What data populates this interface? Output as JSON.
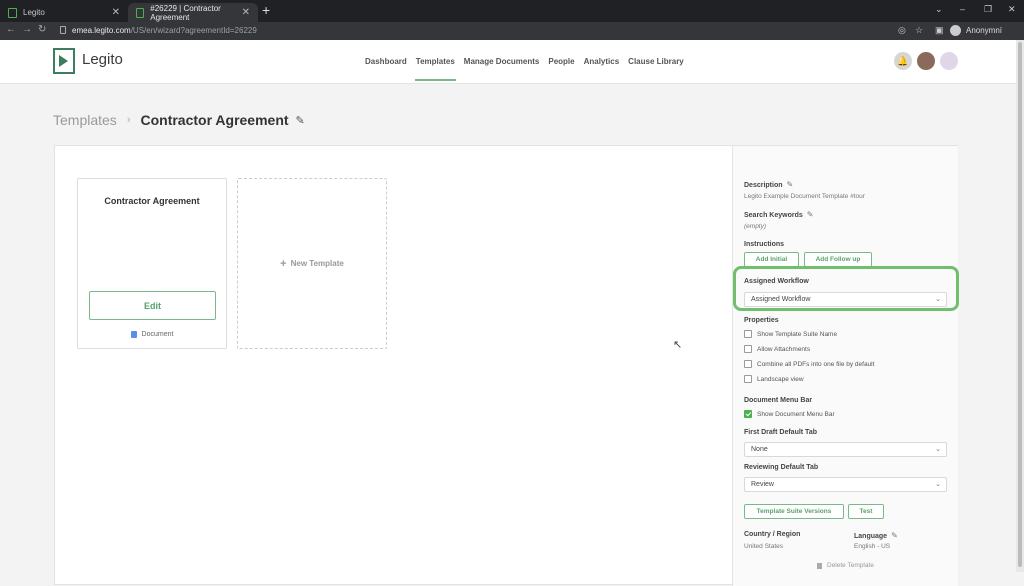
{
  "browser": {
    "tabs": [
      {
        "label": "Legito"
      },
      {
        "label": "#26229 | Contractor Agreement"
      }
    ],
    "new_tab": "+",
    "url_host": "emea.legito.com",
    "url_path": "/US/en/wizard?agreementId=26229",
    "profile": "Anonymní"
  },
  "app": {
    "brand": "Legito",
    "nav": [
      "Dashboard",
      "Templates",
      "Manage Documents",
      "People",
      "Analytics",
      "Clause Library"
    ],
    "active_nav": "Templates"
  },
  "breadcrumb": {
    "root": "Templates",
    "separator": "›",
    "title": "Contractor Agreement"
  },
  "card": {
    "title": "Contractor Agreement",
    "edit_label": "Edit",
    "doc_label": "Document"
  },
  "new_template": {
    "plus": "+",
    "label": "New Template"
  },
  "sidebar": {
    "description_label": "Description",
    "description_value": "Legito Example Document Template #tour",
    "keywords_label": "Search Keywords",
    "keywords_value": "(empty)",
    "instructions_label": "Instructions",
    "add_initial": "Add Initial",
    "add_follow_up": "Add Follow up",
    "workflow_label": "Assigned Workflow",
    "workflow_value": "Assigned Workflow",
    "properties_label": "Properties",
    "properties": [
      {
        "label": "Show Template Suite Name",
        "checked": false
      },
      {
        "label": "Allow Attachments",
        "checked": false
      },
      {
        "label": "Combine all PDFs into one file by default",
        "checked": false
      },
      {
        "label": "Landscape view",
        "checked": false
      }
    ],
    "menu_bar_label": "Document Menu Bar",
    "menu_bar_option": "Show Document Menu Bar",
    "first_draft_label": "First Draft Default Tab",
    "first_draft_value": "None",
    "reviewing_label": "Reviewing Default Tab",
    "reviewing_value": "Review",
    "suite_versions": "Template Suite Versions",
    "test": "Test",
    "country_label": "Country / Region",
    "country_value": "United States",
    "language_label": "Language",
    "language_value": "English - US",
    "delete": "Delete Template"
  },
  "colors": {
    "accent": "#5aa06c",
    "highlight": "#6fbf6f"
  }
}
